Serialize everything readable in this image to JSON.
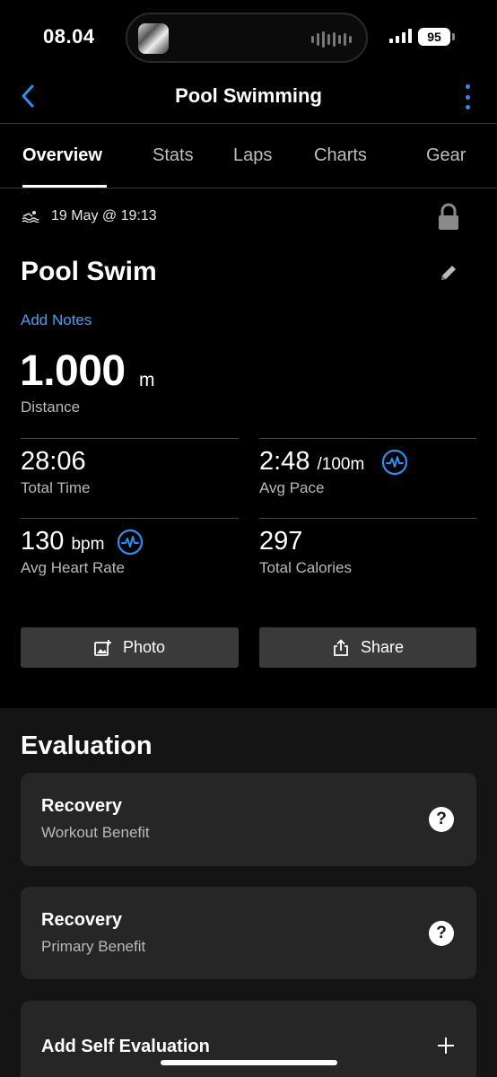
{
  "status_bar": {
    "time": "08.04",
    "battery": "95"
  },
  "nav": {
    "title": "Pool Swimming"
  },
  "tabs": [
    {
      "label": "Overview",
      "active": true
    },
    {
      "label": "Stats"
    },
    {
      "label": "Laps"
    },
    {
      "label": "Charts"
    },
    {
      "label": "Gear"
    }
  ],
  "overview": {
    "date": "19 May @ 19:13",
    "activity_name": "Pool Swim",
    "add_notes": "Add Notes",
    "distance": {
      "value": "1.000",
      "unit": "m",
      "label": "Distance"
    },
    "stats": {
      "total_time": {
        "value": "28:06",
        "label": "Total Time"
      },
      "avg_pace": {
        "value": "2:48",
        "unit": "/100m",
        "label": "Avg Pace"
      },
      "avg_hr": {
        "value": "130",
        "unit": "bpm",
        "label": "Avg Heart Rate"
      },
      "calories": {
        "value": "297",
        "label": "Total Calories"
      }
    },
    "buttons": {
      "photo": "Photo",
      "share": "Share"
    }
  },
  "evaluation": {
    "heading": "Evaluation",
    "cards": [
      {
        "title": "Recovery",
        "subtitle": "Workout Benefit"
      },
      {
        "title": "Recovery",
        "subtitle": "Primary Benefit"
      }
    ],
    "self_eval": "Add Self Evaluation"
  },
  "colors": {
    "accent_blue": "#2f8cf0",
    "link_blue": "#4a9ff5",
    "background": "#000000",
    "card": "#262626"
  },
  "icons": [
    "back-chevron-icon",
    "more-vertical-icon",
    "swim-icon",
    "lock-icon",
    "edit-pencil-icon",
    "pulse-icon",
    "add-photo-icon",
    "share-icon",
    "help-icon",
    "plus-icon"
  ]
}
